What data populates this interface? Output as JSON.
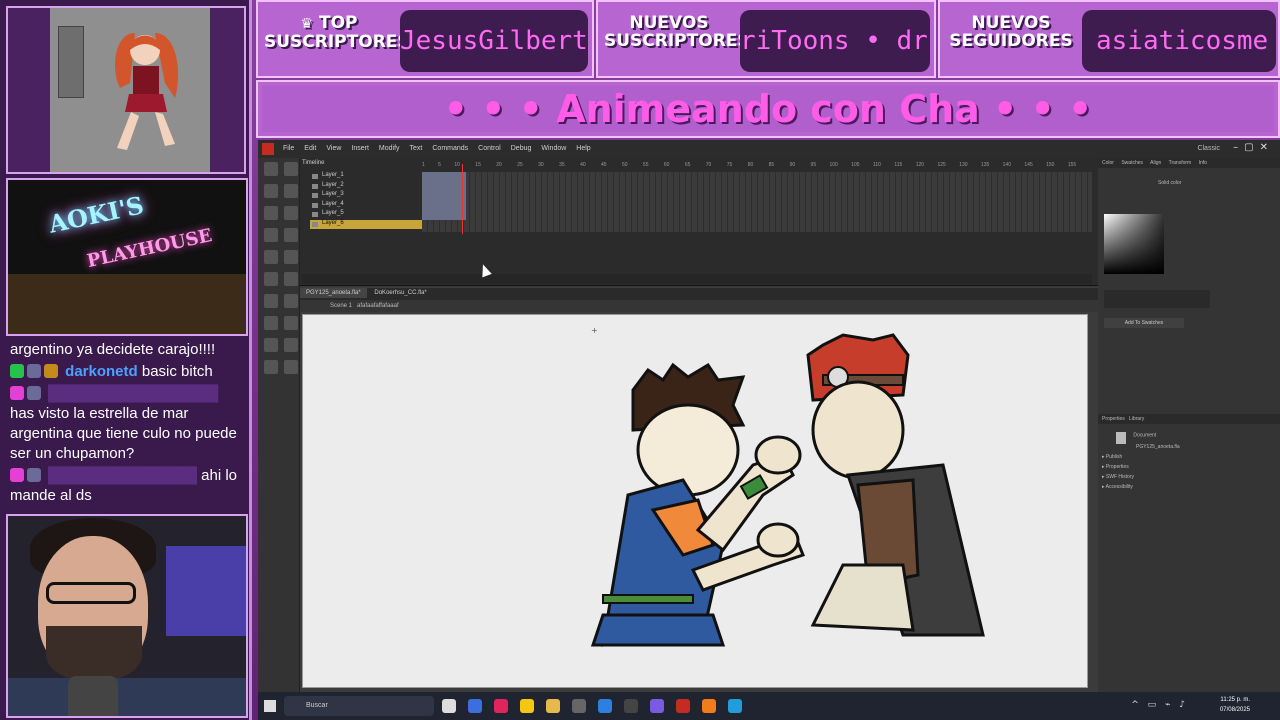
{
  "banner": {
    "top_subs_label": "TOP SUSCRIPTORES",
    "top_subs_ticker": "JesusGilbert",
    "new_subs_label": "NUEVOS SUSCRIPTORES",
    "new_subs_ticker": "riToons • dr",
    "new_followers_label": "NUEVOS SEGUIDORES",
    "new_followers_ticker": "asiaticosme"
  },
  "title": "• • • Animeando con Cha • • •",
  "webcam_sign": {
    "line1": "AOKI'S",
    "line2": "PLAYHOUSE"
  },
  "chat": [
    {
      "user": "",
      "text": "argentino ya decidete carajo!!!!"
    },
    {
      "user": "darkonetd",
      "text": "basic bitch"
    },
    {
      "user": "",
      "text": "has visto la estrella de mar argentina que tiene culo no puede ser un chupamon?"
    },
    {
      "user": "",
      "text": "ahi lo mande al ds"
    }
  ],
  "app": {
    "menu": [
      "File",
      "Edit",
      "View",
      "Insert",
      "Modify",
      "Text",
      "Commands",
      "Control",
      "Debug",
      "Window",
      "Help"
    ],
    "workspace": "Classic",
    "timeline_tab": "Timeline",
    "layers": [
      "Layer_1",
      "Layer_2",
      "Layer_3",
      "Layer_4",
      "Layer_5",
      "Layer_6"
    ],
    "active_layer_index": 5,
    "ruler_ticks": [
      "1",
      "5",
      "10",
      "15",
      "20",
      "25",
      "30",
      "35",
      "40",
      "45",
      "50",
      "55",
      "60",
      "65",
      "70",
      "75",
      "80",
      "85",
      "90",
      "95",
      "100",
      "105",
      "110",
      "115",
      "120",
      "125",
      "130",
      "135",
      "140",
      "145",
      "150",
      "155"
    ],
    "doc_tabs": [
      "PGY125_anoeta.fla*",
      "DoKoerhsu_CC.fla*"
    ],
    "scene": "Scene 1",
    "symbol": "afafaafaffafaaaf",
    "right_tabs": [
      "Color",
      "Swatches",
      "Align",
      "Transform",
      "Info"
    ],
    "solid_color": "Solid color",
    "add_swatches": "Add To Swatches",
    "properties_tabs": [
      "Properties",
      "Library"
    ],
    "doc_label": "Document",
    "doc_file": "PGY125_anoeta.fla",
    "sections": [
      "Publish",
      "Properties",
      "SWF History",
      "Accessibility"
    ]
  },
  "taskbar": {
    "search_placeholder": "Buscar",
    "time": "11:25 p. m.",
    "date": "07/08/2025"
  },
  "colors": {
    "purple_bg": "#6a2c80",
    "banner": "#b766d1",
    "ticker_text": "#ff6bf3",
    "title_text": "#ff5ce8"
  }
}
